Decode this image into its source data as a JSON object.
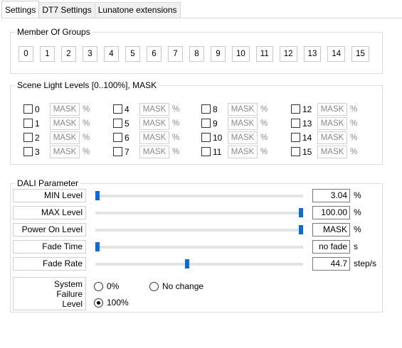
{
  "tabs": [
    {
      "label": "Settings",
      "active": true
    },
    {
      "label": "DT7 Settings",
      "active": false
    },
    {
      "label": "Lunatone extensions",
      "active": false
    }
  ],
  "groups": {
    "title": "Member Of Groups",
    "buttons": [
      "0",
      "1",
      "2",
      "3",
      "4",
      "5",
      "6",
      "7",
      "8",
      "9",
      "10",
      "11",
      "12",
      "13",
      "14",
      "15"
    ]
  },
  "scenes": {
    "title": "Scene Light Levels [0..100%], MASK",
    "items": [
      {
        "num": "0",
        "value": "MASK",
        "unit": "%"
      },
      {
        "num": "1",
        "value": "MASK",
        "unit": "%"
      },
      {
        "num": "2",
        "value": "MASK",
        "unit": "%"
      },
      {
        "num": "3",
        "value": "MASK",
        "unit": "%"
      },
      {
        "num": "4",
        "value": "MASK",
        "unit": "%"
      },
      {
        "num": "5",
        "value": "MASK",
        "unit": "%"
      },
      {
        "num": "6",
        "value": "MASK",
        "unit": "%"
      },
      {
        "num": "7",
        "value": "MASK",
        "unit": "%"
      },
      {
        "num": "8",
        "value": "MASK",
        "unit": "%"
      },
      {
        "num": "9",
        "value": "MASK",
        "unit": "%"
      },
      {
        "num": "10",
        "value": "MASK",
        "unit": "%"
      },
      {
        "num": "11",
        "value": "MASK",
        "unit": "%"
      },
      {
        "num": "12",
        "value": "MASK",
        "unit": "%"
      },
      {
        "num": "13",
        "value": "MASK",
        "unit": "%"
      },
      {
        "num": "14",
        "value": "MASK",
        "unit": "%"
      },
      {
        "num": "15",
        "value": "MASK",
        "unit": "%"
      }
    ]
  },
  "dali": {
    "title": "DALI Parameter",
    "params": [
      {
        "label": "MIN Level",
        "value": "3.04",
        "unit": "%",
        "slider": 0.0
      },
      {
        "label": "MAX Level",
        "value": "100.00",
        "unit": "%",
        "slider": 1.0
      },
      {
        "label": "Power On Level",
        "value": "MASK",
        "unit": "%",
        "slider": 1.0
      },
      {
        "label": "Fade Time",
        "value": "no fade",
        "unit": "s",
        "slider": 0.0
      },
      {
        "label": "Fade Rate",
        "value": "44.7",
        "unit": "step/s",
        "slider": 0.44
      }
    ],
    "system_failure": {
      "label_line1": "System",
      "label_line2": "Failure",
      "label_line3": "Level",
      "options": [
        {
          "label": "0%",
          "selected": false
        },
        {
          "label": "No change",
          "selected": false
        },
        {
          "label": "100%",
          "selected": true
        }
      ]
    }
  },
  "colors": {
    "slider_thumb": "#0a6cd6"
  }
}
